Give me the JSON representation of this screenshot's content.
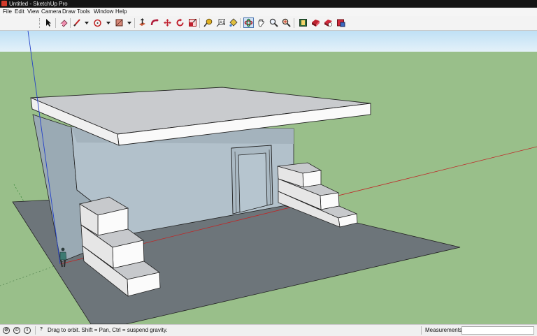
{
  "window": {
    "title": "Untitled - SketchUp Pro"
  },
  "menu": [
    {
      "label": "File"
    },
    {
      "label": "Edit"
    },
    {
      "label": "View"
    },
    {
      "label": "Camera"
    },
    {
      "label": "Draw"
    },
    {
      "label": "Tools"
    },
    {
      "label": "Window"
    },
    {
      "label": "Help"
    }
  ],
  "toolbar": {
    "active_tool": "orbit",
    "buttons": [
      {
        "name": "select-icon"
      },
      {
        "name": "eraser-icon"
      },
      {
        "name": "line-icon"
      },
      {
        "name": "arc-icon"
      },
      {
        "name": "shape-icon"
      },
      {
        "name": "push-pull-icon"
      },
      {
        "name": "follow-me-icon"
      },
      {
        "name": "move-icon"
      },
      {
        "name": "rotate-icon"
      },
      {
        "name": "scale-icon"
      },
      {
        "name": "tape-measure-icon"
      },
      {
        "name": "text-icon"
      },
      {
        "name": "paint-bucket-icon"
      },
      {
        "name": "orbit-icon"
      },
      {
        "name": "pan-icon"
      },
      {
        "name": "zoom-icon"
      },
      {
        "name": "zoom-extents-icon"
      },
      {
        "name": "3d-warehouse-icon"
      },
      {
        "name": "share-model-icon"
      },
      {
        "name": "get-models-icon"
      },
      {
        "name": "extension-warehouse-icon"
      }
    ]
  },
  "viewport": {
    "sky_color": "#d7ebf7",
    "ground_color": "#99bf8a",
    "slab_color": "#6d757a",
    "wall_color": "#b2c1cb"
  },
  "status": {
    "hint": "Drag to orbit. Shift = Pan, Ctrl = suspend gravity.",
    "measurements_label": "Measurements",
    "measurements_value": ""
  }
}
